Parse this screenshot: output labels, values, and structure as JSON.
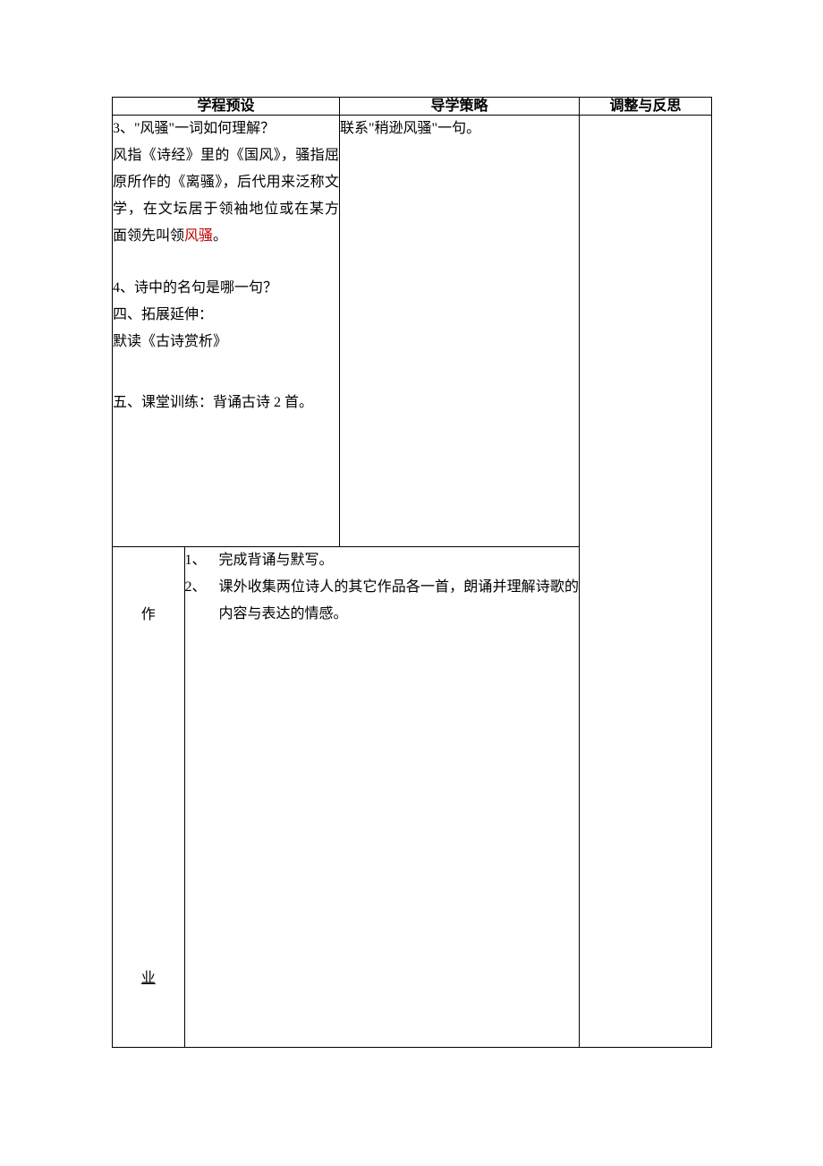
{
  "headers": {
    "col1": "学程预设",
    "col2": "导学策略",
    "col3": "调整与反思"
  },
  "left": {
    "q3_title": "3、\"风骚\"一词如何理解？",
    "q3_body_1": "风指《诗经》里的《国风》，骚指屈原所作的《离骚》，后代用来泛称文学，在文坛居于领袖地位或在某方面领先叫领",
    "q3_body_2_red": "风骚",
    "q3_body_3": "。",
    "q4_title": "4、诗中的名句是哪一句？",
    "sec4_title": "四、拓展延伸：",
    "sec4_body": "默读《古诗赏析》",
    "sec5": "五、课堂训练：背诵古诗 2 首。"
  },
  "right": {
    "note": "联系\"稍逊风骚\"一句。"
  },
  "homework": {
    "label_top": "作",
    "label_bottom": "业",
    "items": [
      {
        "num": "1、",
        "text": "完成背诵与默写。"
      },
      {
        "num": "2、",
        "text": "课外收集两位诗人的其它作品各一首，朗诵并理解诗歌的内容与表达的情感。"
      }
    ]
  }
}
